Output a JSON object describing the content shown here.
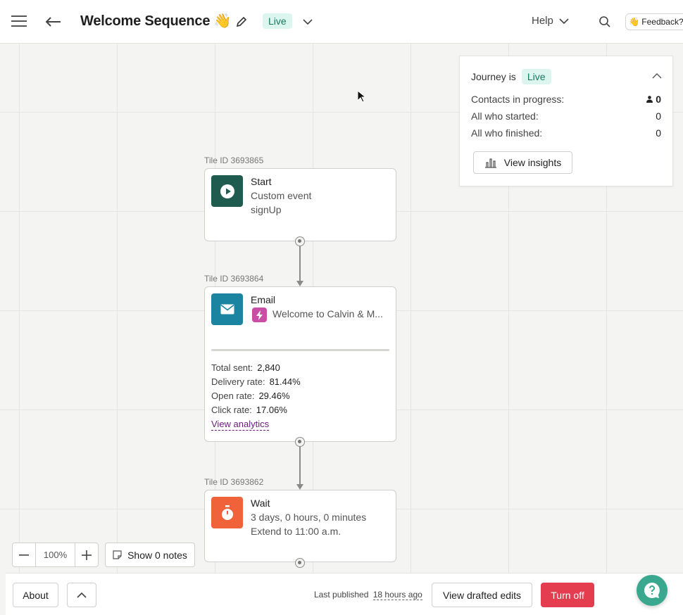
{
  "header": {
    "title": "Welcome Sequence",
    "title_emoji": "👋",
    "status": "Live",
    "help_label": "Help",
    "feedback_label": "👋 Feedback?"
  },
  "journey_panel": {
    "label": "Journey is",
    "status": "Live",
    "rows": [
      {
        "label": "Contacts in progress:",
        "value": "0"
      },
      {
        "label": "All who started:",
        "value": "0"
      },
      {
        "label": "All who finished:",
        "value": "0"
      }
    ],
    "insights_button": "View insights"
  },
  "tiles": {
    "start": {
      "id_label": "Tile ID 3693865",
      "title": "Start",
      "line1": "Custom event",
      "line2": "signUp"
    },
    "email": {
      "id_label": "Tile ID 3693864",
      "title": "Email",
      "subject": "Welcome to Calvin & M...",
      "stats": [
        {
          "label": "Total sent:",
          "value": "2,840"
        },
        {
          "label": "Delivery rate:",
          "value": "81.44%"
        },
        {
          "label": "Open rate:",
          "value": "29.46%"
        },
        {
          "label": "Click rate:",
          "value": "17.06%"
        }
      ],
      "analytics_link": "View analytics"
    },
    "wait": {
      "id_label": "Tile ID 3693862",
      "title": "Wait",
      "line1": "3 days, 0 hours, 0 minutes",
      "line2": "Extend to 11:00 a.m."
    }
  },
  "zoom": {
    "level": "100%",
    "notes_button": "Show 0 notes"
  },
  "footer": {
    "about_button": "About",
    "last_published_label": "Last published",
    "last_published_value": "18 hours ago",
    "drafted_edits_button": "View drafted edits",
    "turn_off_button": "Turn off"
  },
  "colors": {
    "accent_green": "#1f5c4f",
    "email_blue": "#1b84a0",
    "wait_orange": "#f0623a",
    "turn_off_red": "#e43d50",
    "live_bg": "#dcf5ef",
    "link_purple": "#6a1b7a",
    "fab_teal": "#3aa88f"
  },
  "icons": [
    "menu-icon",
    "back-arrow-icon",
    "pencil-icon",
    "chevron-down-icon",
    "search-icon",
    "play-icon",
    "envelope-icon",
    "lightning-icon",
    "stopwatch-icon",
    "bar-chart-icon",
    "note-icon",
    "chevron-up-icon",
    "question-icon",
    "person-icon"
  ]
}
